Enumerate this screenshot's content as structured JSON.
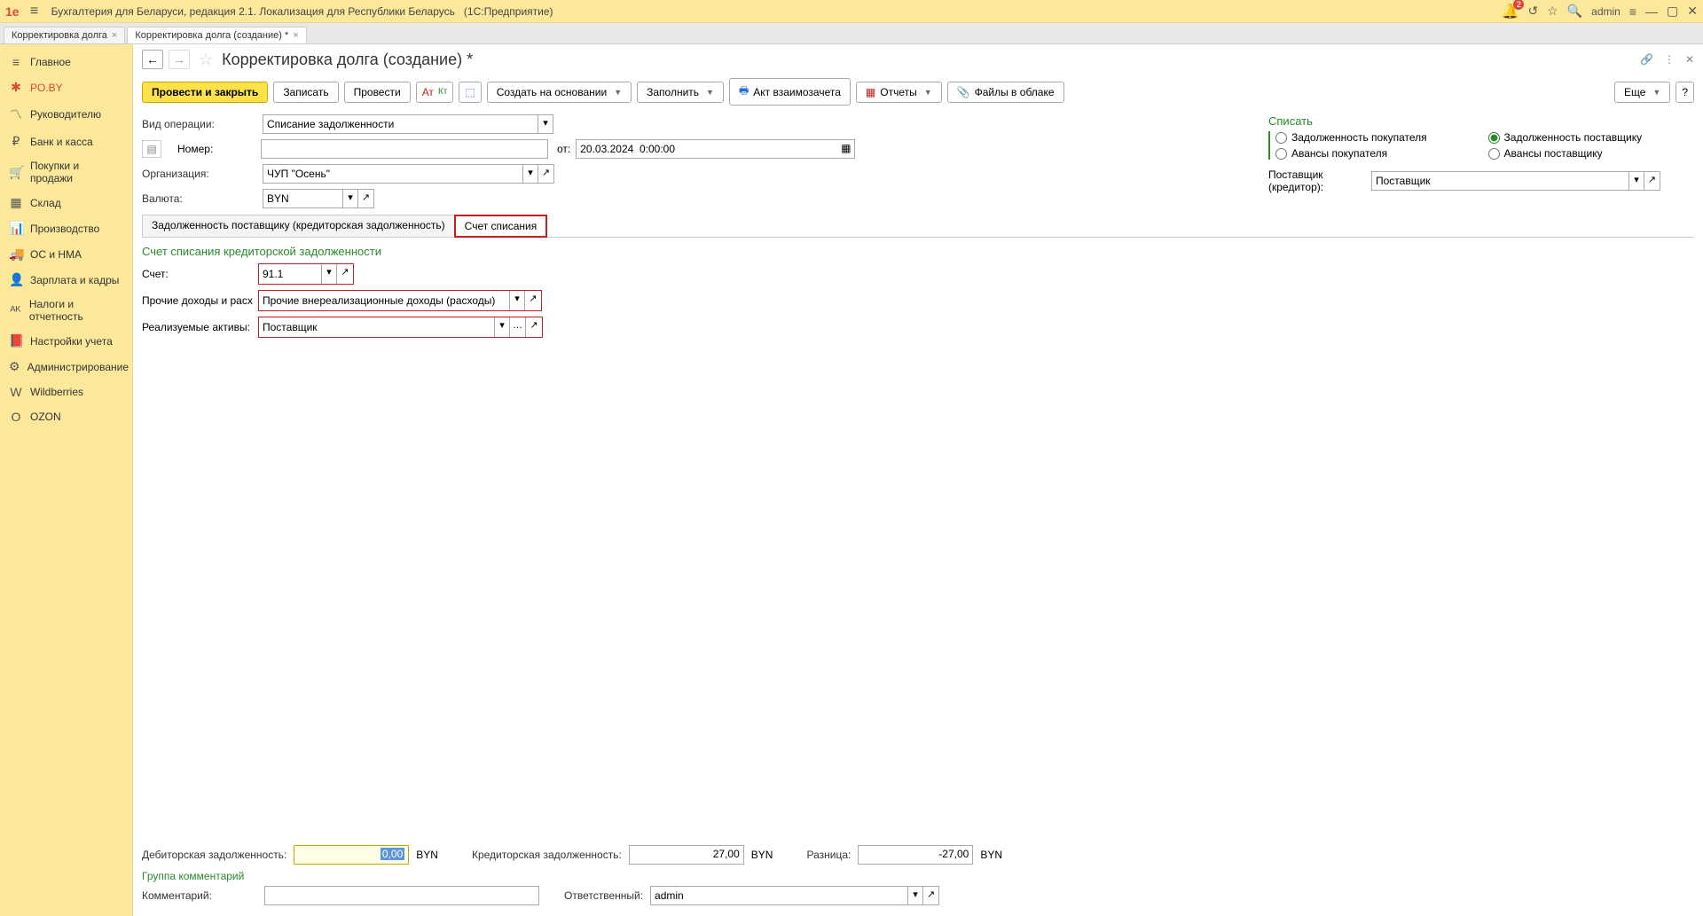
{
  "titlebar": {
    "app_name": "Бухгалтерия для Беларуси, редакция 2.1. Локализация для Республики Беларусь",
    "platform": "(1С:Предприятие)",
    "logo": "1e",
    "notif_count": "2",
    "user": "admin"
  },
  "tabs": {
    "t0": "Корректировка долга",
    "t1": "Корректировка долга (создание) *"
  },
  "sidebar": {
    "items": [
      {
        "icon": "≡",
        "label": "Главное"
      },
      {
        "icon": "✱",
        "label": "PO.BY"
      },
      {
        "icon": "〽",
        "label": "Руководителю"
      },
      {
        "icon": "₽",
        "label": "Банк и касса"
      },
      {
        "icon": "🛒",
        "label": "Покупки и продажи"
      },
      {
        "icon": "▦",
        "label": "Склад"
      },
      {
        "icon": "📊",
        "label": "Производство"
      },
      {
        "icon": "🚚",
        "label": "ОС и НМА"
      },
      {
        "icon": "👤",
        "label": "Зарплата и кадры"
      },
      {
        "icon": "ᴬᴷ",
        "label": "Налоги и отчетность"
      },
      {
        "icon": "📕",
        "label": "Настройки учета"
      },
      {
        "icon": "⚙",
        "label": "Администрирование"
      },
      {
        "icon": "W",
        "label": "Wildberries"
      },
      {
        "icon": "O",
        "label": "OZON"
      }
    ]
  },
  "page": {
    "title": "Корректировка долга (создание) *"
  },
  "toolbar": {
    "post_close": "Провести и закрыть",
    "save": "Записать",
    "post": "Провести",
    "create_based": "Создать на основании",
    "fill": "Заполнить",
    "act": "Акт взаимозачета",
    "reports": "Отчеты",
    "files": "Файлы в облаке",
    "more": "Еще"
  },
  "form": {
    "op_type_label": "Вид операции:",
    "op_type_value": "Списание задолженности",
    "number_label": "Номер:",
    "number_value": "",
    "from_label": "от:",
    "date_value": "20.03.2024  0:00:00",
    "org_label": "Организация:",
    "org_value": "ЧУП \"Осень\"",
    "currency_label": "Валюта:",
    "currency_value": "BYN"
  },
  "right": {
    "group": "Списать",
    "opt1": "Задолженность покупателя",
    "opt2": "Задолженность поставщику",
    "opt3": "Авансы покупателя",
    "opt4": "Авансы поставщику",
    "supplier_label": "Поставщик (кредитор):",
    "supplier_value": "Поставщик"
  },
  "subtabs": {
    "t0": "Задолженность поставщику (кредиторская задолженность)",
    "t1": "Счет списания"
  },
  "panel": {
    "title": "Счет списания кредиторской задолженности",
    "account_label": "Счет:",
    "account_value": "91.1",
    "income_label": "Прочие доходы и расх...:",
    "income_value": "Прочие внереализационные доходы (расходы)",
    "assets_label": "Реализуемые активы:",
    "assets_value": "Поставщик"
  },
  "footer": {
    "deb_label": "Дебиторская задолженность:",
    "deb_value": "0,00",
    "deb_ccy": "BYN",
    "cred_label": "Кредиторская задолженность:",
    "cred_value": "27,00",
    "cred_ccy": "BYN",
    "diff_label": "Разница:",
    "diff_value": "-27,00",
    "diff_ccy": "BYN",
    "group_comment": "Группа комментарий",
    "comment_label": "Комментарий:",
    "comment_value": "",
    "resp_label": "Ответственный:",
    "resp_value": "admin"
  }
}
